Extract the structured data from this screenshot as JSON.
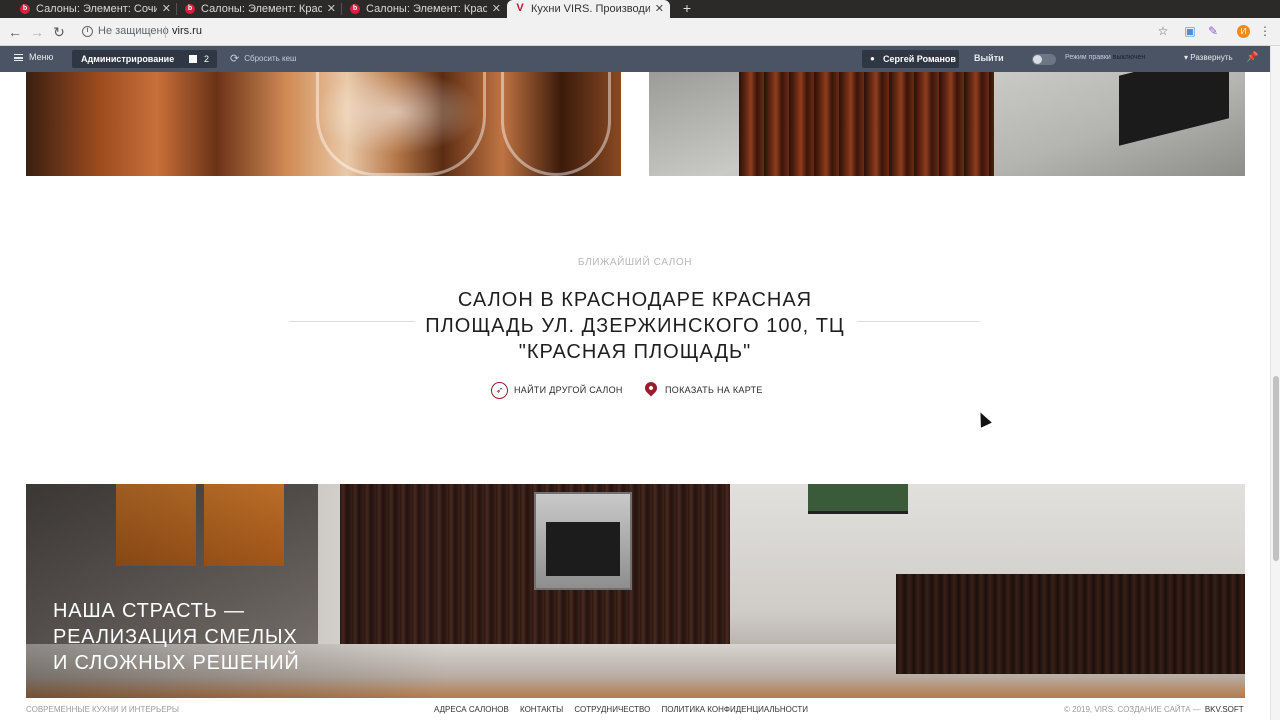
{
  "tabs": [
    {
      "title": "Салоны: Элемент: Сочи",
      "active": false
    },
    {
      "title": "Салоны: Элемент: Крас",
      "active": false
    },
    {
      "title": "Салоны: Элемент: Крас",
      "active": false
    },
    {
      "title": "Кухни VIRS. Производит",
      "active": true
    }
  ],
  "tab_favicon_letter": "V",
  "tab_close": "✕",
  "newtab_label": "+",
  "address": {
    "security_text": "Не защищено",
    "url": "virs.ru"
  },
  "extension_badge": "И",
  "admin_bar": {
    "menu_label": "Меню",
    "admin_label": "Администрирование",
    "notifications_count": "2",
    "cache_label": "Сбросить кеш",
    "user_name": "Сергей Романов",
    "logout_label": "Выйти",
    "edit_mode_label": "Режим правки",
    "edit_mode_state": "выключен",
    "expand_label": "Развернуть"
  },
  "salon": {
    "eyebrow": "БЛИЖАЙШИЙ САЛОН",
    "title": "САЛОН В КРАСНОДАРЕ КРАСНАЯ ПЛОЩАДЬ УЛ. ДЗЕРЖИНСКОГО 100, ТЦ \"КРАСНАЯ ПЛОЩАДЬ\"",
    "find_other_label": "НАЙТИ ДРУГОЙ САЛОН",
    "show_on_map_label": "ПОКАЗАТЬ НА КАРТЕ"
  },
  "banner": {
    "line1": "НАША СТРАСТЬ —",
    "line2": "РЕАЛИЗАЦИЯ СМЕЛЫХ",
    "line3": "И СЛОЖНЫХ РЕШЕНИЙ"
  },
  "footer": {
    "tagline": "СОВРЕМЕННЫЕ КУХНИ И ИНТЕРЬЕРЫ",
    "links": [
      "АДРЕСА САЛОНОВ",
      "КОНТАКТЫ",
      "СОТРУДНИЧЕСТВО",
      "ПОЛИТИКА КОНФИДЕНЦИАЛЬНОСТИ"
    ],
    "copyright": "© 2019, VIRS. СОЗДАНИЕ САЙТА —",
    "developer": "BKV.SOFT"
  },
  "colors": {
    "accent": "#9b1c2a",
    "admin_bar_bg": "#4a5464",
    "tabstrip_bg": "#2b2a28"
  }
}
